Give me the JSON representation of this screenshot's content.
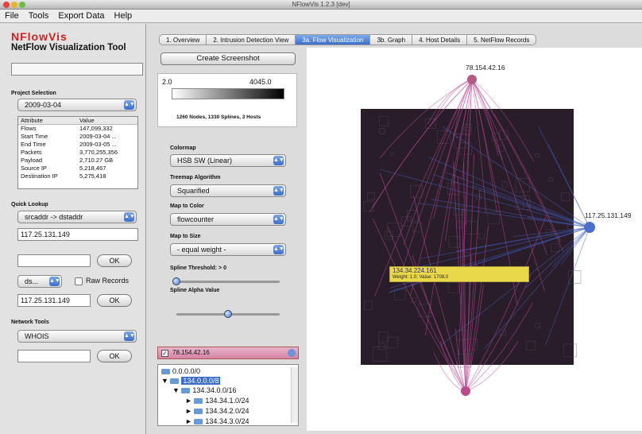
{
  "window": {
    "title": "NFlowVis 1.2.3 [dev]"
  },
  "menu": [
    "File",
    "Tools",
    "Export Data",
    "Help"
  ],
  "app": {
    "name": "NFlowVis",
    "subtitle": "NetFlow Visualization Tool"
  },
  "project": {
    "label": "Project Selection",
    "date": "2009-03-04",
    "table_headers": [
      "Attribute",
      "Value"
    ],
    "rows": [
      [
        "Flows",
        "147,099,332"
      ],
      [
        "Start Time",
        "2009-03-04 ..."
      ],
      [
        "End Time",
        "2009-03-05 ..."
      ],
      [
        "Packets",
        "3,770,255,356"
      ],
      [
        "Payload",
        "2,710.27 GB"
      ],
      [
        "Source IP",
        "5,218,467"
      ],
      [
        "Destination IP",
        "5,275,418"
      ]
    ]
  },
  "quick_lookup": {
    "label": "Quick Lookup",
    "mode": "srcaddr -> dstaddr",
    "value1": "117.25.131.149",
    "value2": "",
    "ok1": "OK",
    "dir": "ds...",
    "raw_label": "Raw Records",
    "value3": "117.25.131.149",
    "ok2": "OK"
  },
  "network_tools": {
    "label": "Network Tools",
    "tool": "WHOIS",
    "value": "",
    "ok": "OK"
  },
  "tabs": [
    "1. Overview",
    "2. Intrusion Detection View",
    "3a. Flow Visualization",
    "3b. Graph",
    "4. Host Details",
    "5. NetFlow Records"
  ],
  "active_tab": 2,
  "controls": {
    "screenshot_btn": "Create Screenshot",
    "legend_min": "2.0",
    "legend_max": "4045.0",
    "legend_info": "1260 Nodes, 1330 Splines, 3 Hosts",
    "colormap_label": "Colormap",
    "colormap": "HSB SW (Linear)",
    "treemap_label": "Treemap Algorithm",
    "treemap": "Squarified",
    "map_color_label": "Map to Color",
    "map_color": "flowcounter",
    "map_size_label": "Map to Size",
    "map_size": "- equal weight -",
    "spline_thr_label": "Spline Threshold: > 0",
    "spline_alpha_label": "Spline Alpha Value",
    "spline_threshold": 0.0,
    "spline_alpha": 0.5
  },
  "host_list": {
    "selected": "78.154.42.16"
  },
  "tree": [
    "0.0.0.0/0",
    "134.0.0.0/8",
    "134.34.0.0/16",
    "134.34.1.0/24",
    "134.34.2.0/24",
    "134.34.3.0/24"
  ],
  "viz": {
    "host_top": "78.154.42.16",
    "host_right": "117.25.131.149",
    "tooltip_ip": "134.34.224.161",
    "tooltip_detail": "Weight: 1.0; Value: 1708.0",
    "colors": {
      "magenta": "#c04a9a",
      "blue": "#3f62c6",
      "treemap_bg": "#2a1d2a",
      "highlight": "#e9d94a"
    }
  }
}
